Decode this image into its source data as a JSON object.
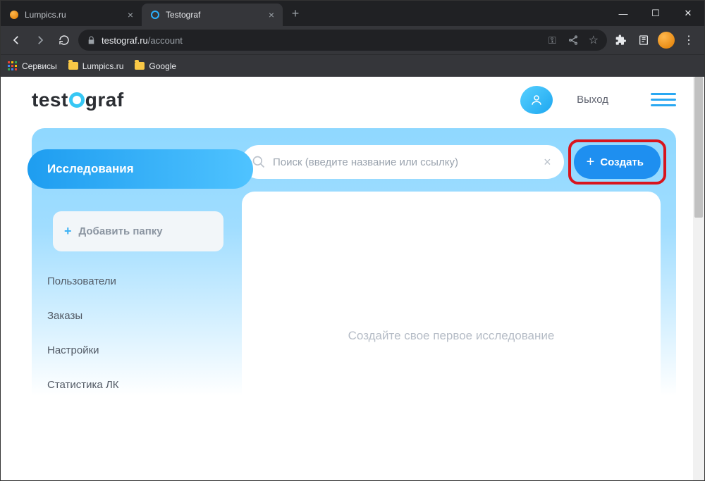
{
  "browser": {
    "tabs": [
      {
        "title": "Lumpics.ru",
        "active": false
      },
      {
        "title": "Testograf",
        "active": true
      }
    ],
    "url_domain": "testograf.ru",
    "url_path": "/account",
    "bookmarks": {
      "apps": "Сервисы",
      "items": [
        "Lumpics.ru",
        "Google"
      ]
    }
  },
  "header": {
    "logo_prefix": "test",
    "logo_suffix": "graf",
    "logout": "Выход"
  },
  "sidebar": {
    "active_tab": "Исследования",
    "add_folder": "Добавить папку",
    "items": [
      "Пользователи",
      "Заказы",
      "Настройки",
      "Статистика ЛК"
    ]
  },
  "main": {
    "search_placeholder": "Поиск (введите название или ссылку)",
    "create_label": "Создать",
    "empty_state": "Создайте свое первое исследование"
  }
}
